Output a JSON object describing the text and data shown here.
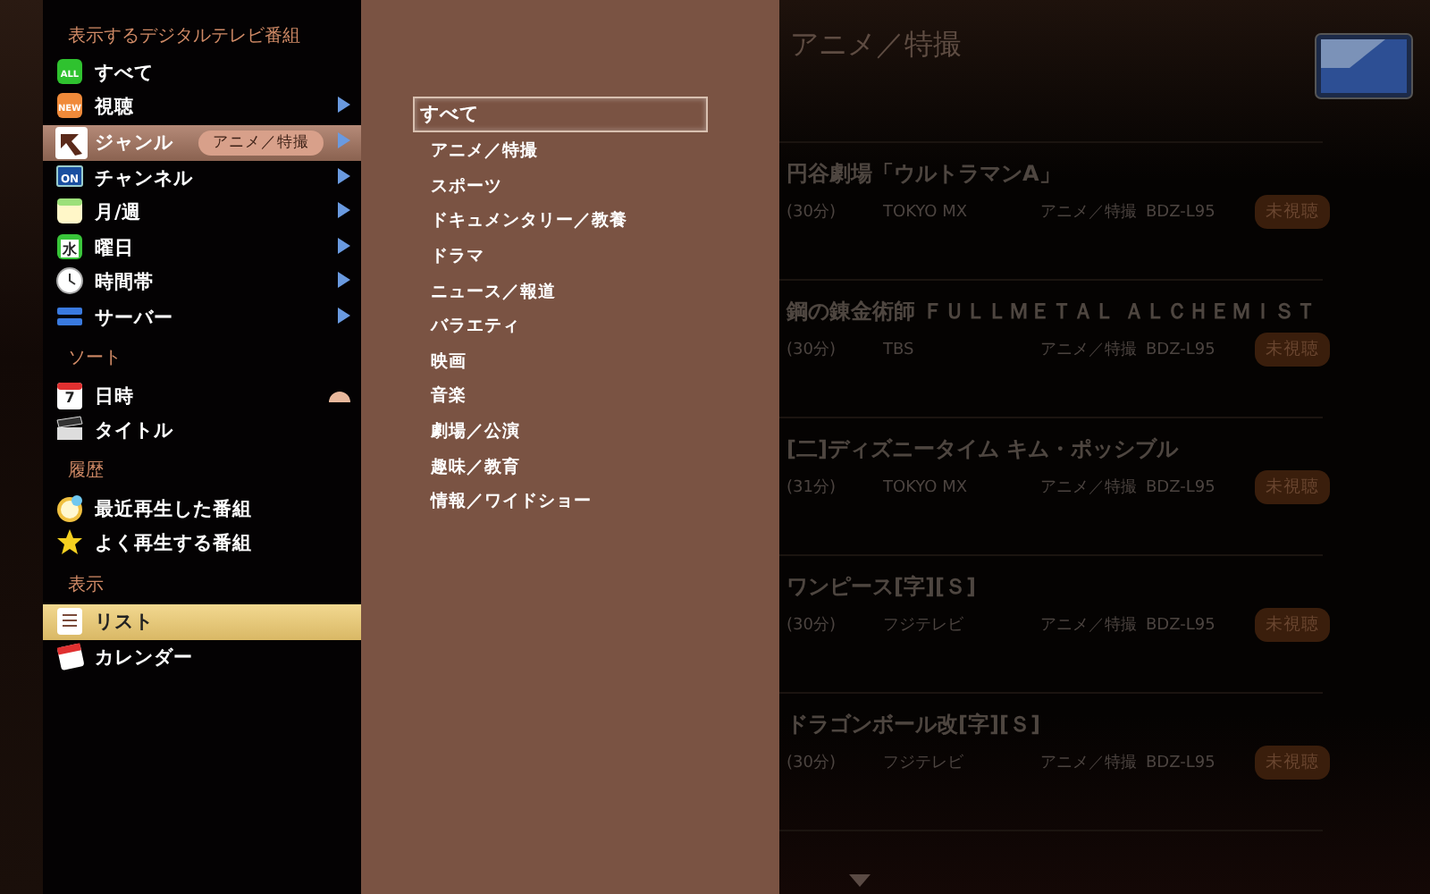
{
  "sidebar": {
    "sections": [
      {
        "heading": "表示するデジタルテレビ番組",
        "items": [
          {
            "label": "すべて",
            "icon_text": "ALL",
            "has_submenu": false,
            "selected": false
          },
          {
            "label": "視聴",
            "icon_text": "NEW",
            "has_submenu": true,
            "expanded": false,
            "selected": false
          },
          {
            "label": "ジャンル",
            "badge": "アニメ／特撮",
            "has_submenu": true,
            "expanded": true,
            "selected": false
          },
          {
            "label": "チャンネル",
            "icon_text": "ON",
            "has_submenu": true,
            "expanded": false,
            "selected": false
          },
          {
            "label": "月/週",
            "has_submenu": true,
            "expanded": false,
            "selected": false
          },
          {
            "label": "曜日",
            "icon_text": "水",
            "has_submenu": true,
            "expanded": false,
            "selected": false
          },
          {
            "label": "時間帯",
            "has_submenu": true,
            "expanded": false,
            "selected": false
          },
          {
            "label": "サーバー",
            "has_submenu": true,
            "expanded": false,
            "selected": false
          }
        ]
      },
      {
        "heading": "ソート",
        "items": [
          {
            "label": "日時",
            "icon_text": "7",
            "has_submenu": false,
            "sort_indicator": true,
            "selected": false
          },
          {
            "label": "タイトル",
            "has_submenu": false,
            "selected": false
          }
        ]
      },
      {
        "heading": "履歴",
        "items": [
          {
            "label": "最近再生した番組",
            "has_submenu": false,
            "selected": false
          },
          {
            "label": "よく再生する番組",
            "has_submenu": false,
            "selected": false
          }
        ]
      },
      {
        "heading": "表示",
        "items": [
          {
            "label": "リスト",
            "has_submenu": false,
            "selected": true
          },
          {
            "label": "カレンダー",
            "has_submenu": false,
            "selected": false
          }
        ]
      }
    ]
  },
  "genre_menu": {
    "options": [
      {
        "label": "すべて",
        "selected": true
      },
      {
        "label": "アニメ／特撮",
        "selected": false
      },
      {
        "label": "スポーツ",
        "selected": false
      },
      {
        "label": "ドキュメンタリー／教養",
        "selected": false
      },
      {
        "label": "ドラマ",
        "selected": false
      },
      {
        "label": "ニュース／報道",
        "selected": false
      },
      {
        "label": "バラエティ",
        "selected": false
      },
      {
        "label": "映画",
        "selected": false
      },
      {
        "label": "音楽",
        "selected": false
      },
      {
        "label": "劇場／公演",
        "selected": false
      },
      {
        "label": "趣味／教育",
        "selected": false
      },
      {
        "label": "情報／ワイドショー",
        "selected": false
      }
    ]
  },
  "program_list": {
    "title": "アニメ／特撮",
    "rows": [
      {
        "title": "円谷劇場「ウルトラマンA」",
        "duration": "(30分)",
        "channel": "TOKYO MX",
        "genre": "アニメ／特撮",
        "recorder": "BDZ-L95",
        "status": "未視聴"
      },
      {
        "title": "鋼の錬金術師 ＦＵＬＬＭＥＴＡＬ ＡＬＣＨＥＭＩＳＴ",
        "duration": "(30分)",
        "channel": "TBS",
        "genre": "アニメ／特撮",
        "recorder": "BDZ-L95",
        "status": "未視聴"
      },
      {
        "title": "[二]ディズニータイム キム・ポッシブル",
        "duration": "(31分)",
        "channel": "TOKYO MX",
        "genre": "アニメ／特撮",
        "recorder": "BDZ-L95",
        "status": "未視聴"
      },
      {
        "title": "ワンピース[字][Ｓ]",
        "duration": "(30分)",
        "channel": "フジテレビ",
        "genre": "アニメ／特撮",
        "recorder": "BDZ-L95",
        "status": "未視聴"
      },
      {
        "title": "ドラゴンボール改[字][Ｓ]",
        "duration": "(30分)",
        "channel": "フジテレビ",
        "genre": "アニメ／特撮",
        "recorder": "BDZ-L95",
        "status": "未視聴"
      }
    ]
  }
}
